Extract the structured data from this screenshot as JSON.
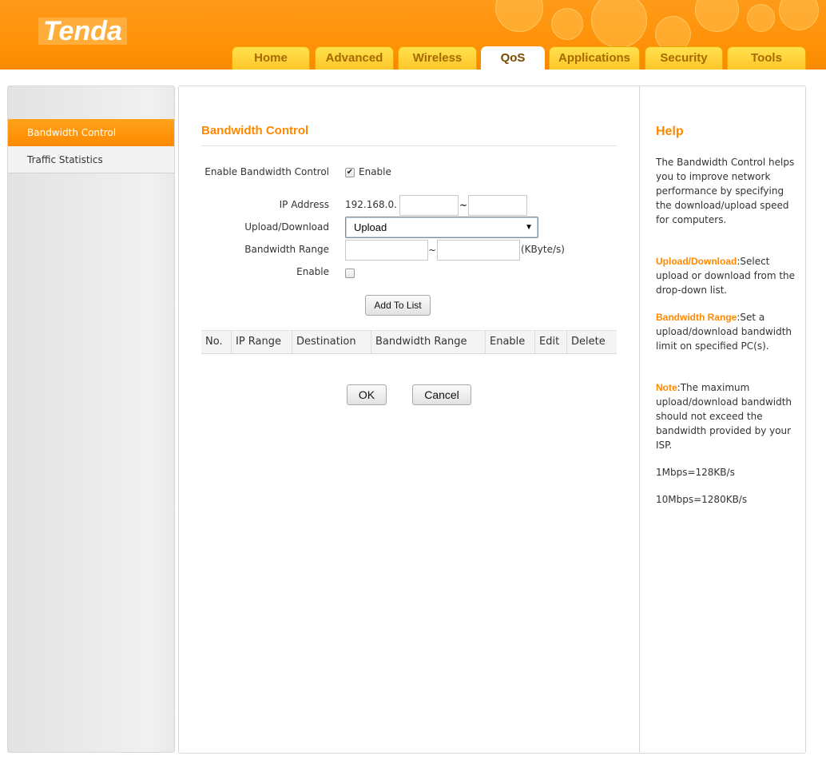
{
  "brand": {
    "logo_text": "Tenda"
  },
  "nav": {
    "tabs": [
      {
        "label": "Home"
      },
      {
        "label": "Advanced"
      },
      {
        "label": "Wireless"
      },
      {
        "label": "QoS"
      },
      {
        "label": "Applications"
      },
      {
        "label": "Security"
      },
      {
        "label": "Tools"
      }
    ],
    "active_tab": "QoS"
  },
  "sidebar": {
    "items": [
      {
        "label": "Bandwidth Control",
        "active": true
      },
      {
        "label": "Traffic Statistics",
        "active": false
      }
    ]
  },
  "form": {
    "title": "Bandwidth Control",
    "enable_bw_label": "Enable Bandwidth Control",
    "enable_bw_checked": true,
    "enable_bw_text": "Enable",
    "ip_label": "IP Address",
    "ip_prefix": "192.168.0.",
    "ip_start": "",
    "ip_end": "",
    "range_sep": "~",
    "updown_label": "Upload/Download",
    "updown_value": "Upload",
    "bw_range_label": "Bandwidth Range",
    "bw_min": "",
    "bw_max": "",
    "bw_unit": "(KByte/s)",
    "enable_label": "Enable",
    "enable_checked": false,
    "add_button": "Add To List",
    "ok_button": "OK",
    "cancel_button": "Cancel"
  },
  "rule_table": {
    "columns": [
      "No.",
      "IP Range",
      "Destination",
      "Bandwidth Range",
      "Enable",
      "Edit",
      "Delete"
    ],
    "rows": []
  },
  "help": {
    "title": "Help",
    "intro": "The Bandwidth Control helps you to improve network performance by specifying the download/upload speed for computers.",
    "updown_key": "Upload/Download",
    "updown_text": ":Select upload or download from the drop-down list.",
    "bw_key": "Bandwidth Range",
    "bw_text": ":Set a upload/download bandwidth limit on specified PC(s).",
    "note_key": "Note",
    "note_text": ":The maximum upload/download bandwidth should not exceed the bandwidth provided by your ISP.",
    "conv1": "1Mbps=128KB/s",
    "conv2": "10Mbps=1280KB/s"
  },
  "colors": {
    "accent": "#ff8800",
    "header": "#ff9208",
    "tab": "#ffc62a"
  }
}
